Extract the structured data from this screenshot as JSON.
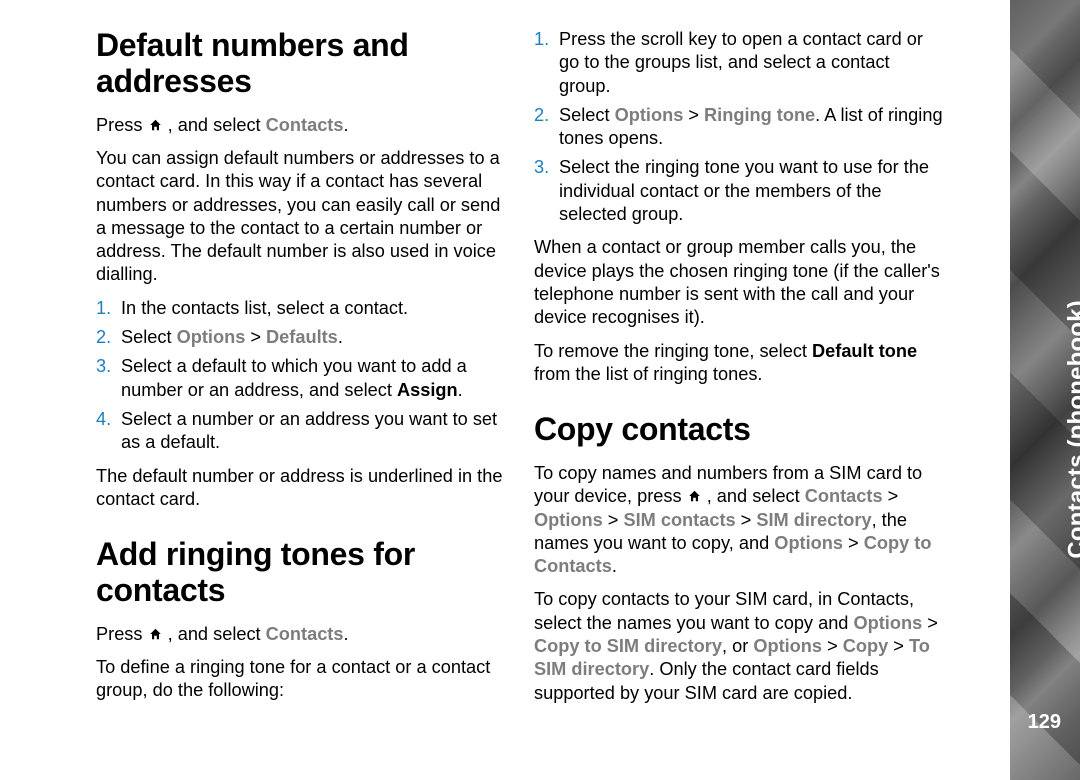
{
  "sidebar": {
    "label": "Contacts (phonebook)",
    "page": "129"
  },
  "col1": {
    "h1": "Default numbers and addresses",
    "p1_a": "Press ",
    "p1_b": " , and select ",
    "p1_contacts": "Contacts",
    "p1_c": ".",
    "p2": "You can assign default numbers or addresses to a contact card. In this way if a contact has several numbers or addresses, you can easily call or send a message to the contact to a certain number or address. The default number is also used in voice dialling.",
    "li1": "In the contacts list, select a contact.",
    "li2_a": "Select ",
    "li2_opt": "Options",
    "li2_gt": " > ",
    "li2_def": "Defaults",
    "li2_b": ".",
    "li3_a": "Select a default to which you want to add a number or an address, and select ",
    "li3_assign": "Assign",
    "li3_b": ".",
    "li4": "Select a number or an address you want to set as a default.",
    "p3": "The default number or address is underlined in the contact card.",
    "h2": "Add ringing tones for contacts",
    "p4_a": "Press ",
    "p4_b": " , and select ",
    "p4_contacts": "Contacts",
    "p4_c": ".",
    "p5": "To define a ringing tone for a contact or a contact group, do the following:"
  },
  "col2": {
    "li1": "Press the scroll key to open a contact card or go to the groups list, and select a contact group.",
    "li2_a": "Select ",
    "li2_opt": "Options",
    "li2_gt": " > ",
    "li2_rt": "Ringing tone",
    "li2_b": ". A list of ringing tones opens.",
    "li3": "Select the ringing tone you want to use for the individual contact or the members of the selected group.",
    "p1": "When a contact or group member calls you, the device plays the chosen ringing tone (if the caller's telephone number is sent with the call and your device recognises it).",
    "p2_a": "To remove the ringing tone, select ",
    "p2_def": "Default tone",
    "p2_b": " from the list of ringing tones.",
    "h1": "Copy contacts",
    "p3_a": "To copy names and numbers from a SIM card to your device, press ",
    "p3_b": " , and select ",
    "p3_contacts": "Contacts",
    "p3_gt1": " > ",
    "p3_opt": "Options",
    "p3_gt2": " > ",
    "p3_simc": "SIM contacts",
    "p3_gt3": " > ",
    "p3_simd": "SIM directory",
    "p3_c": ", the names you want to copy, and ",
    "p3_opt2": "Options",
    "p3_gt4": " > ",
    "p3_ctc": "Copy to Contacts",
    "p3_d": ".",
    "p4_a": "To copy contacts to your SIM card, in Contacts, select the names you want to copy and ",
    "p4_opt": "Options",
    "p4_gt1": " > ",
    "p4_ctsd": "Copy to SIM directory",
    "p4_or": ", or ",
    "p4_opt2": "Options",
    "p4_gt2": " > ",
    "p4_cp": "Copy",
    "p4_gt3": " > ",
    "p4_tsd": "To SIM directory",
    "p4_b": ". Only the contact card fields supported by your SIM card are copied."
  }
}
